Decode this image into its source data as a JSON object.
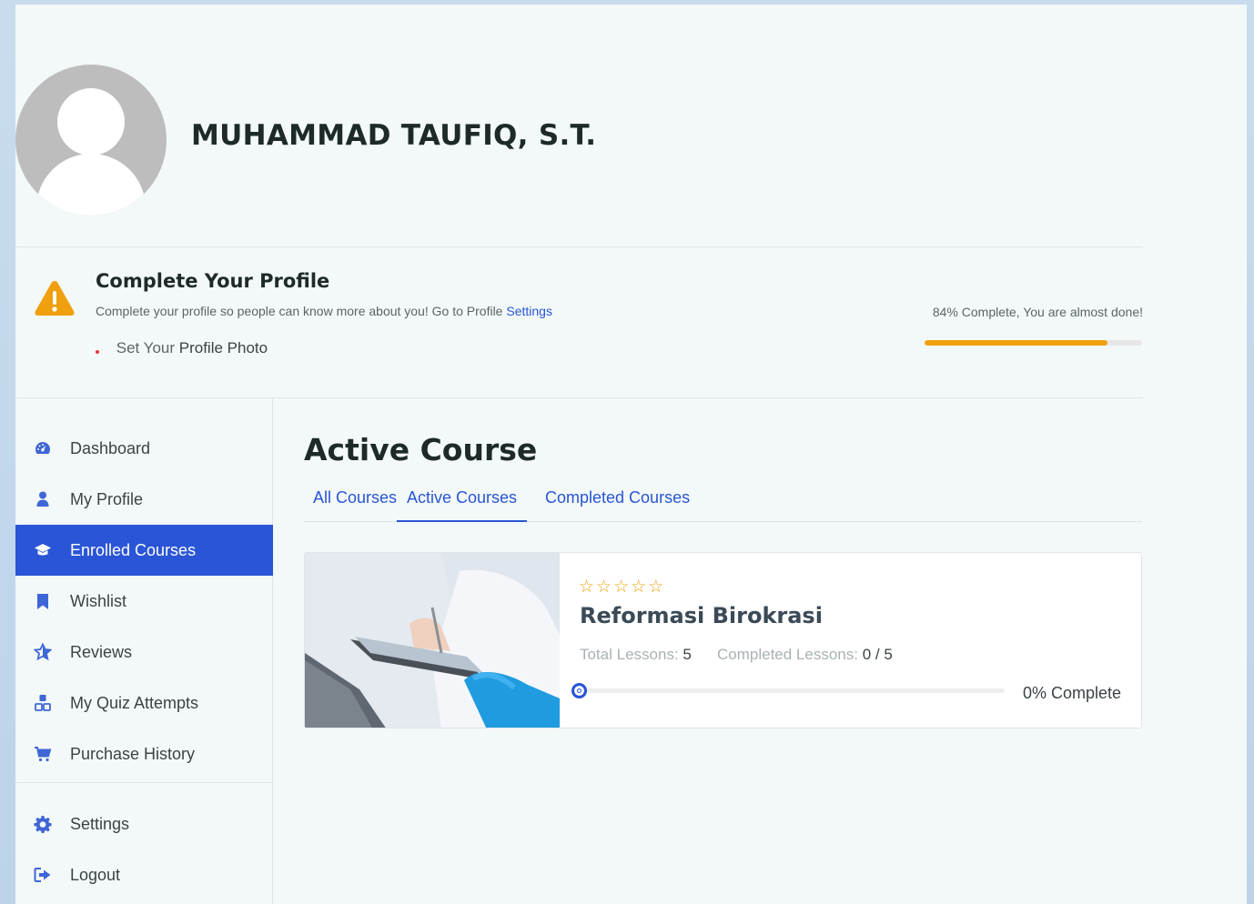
{
  "user": {
    "name": "MUHAMMAD TAUFIQ, S.T."
  },
  "profile_completion": {
    "title": "Complete Your Profile",
    "description": "Complete your profile so people can know more about you! Go to Profile",
    "settings_link": "Settings",
    "item_prefix": "Set Your",
    "item_label": "Profile Photo",
    "percent_text": "84% Complete, You are almost done!",
    "progress": 0.84,
    "bar_color": "#f0a00e"
  },
  "sidebar": {
    "items": [
      {
        "label": "Dashboard",
        "icon": "dashboard-icon"
      },
      {
        "label": "My Profile",
        "icon": "user-icon"
      },
      {
        "label": "Enrolled Courses",
        "icon": "graduation-cap-icon",
        "active": true
      },
      {
        "label": "Wishlist",
        "icon": "bookmark-icon"
      },
      {
        "label": "Reviews",
        "icon": "star-icon"
      },
      {
        "label": "My Quiz Attempts",
        "icon": "quiz-icon"
      },
      {
        "label": "Purchase History",
        "icon": "cart-icon"
      },
      {
        "label": "Settings",
        "icon": "gear-icon"
      },
      {
        "label": "Logout",
        "icon": "logout-icon"
      }
    ]
  },
  "main": {
    "title": "Active Course",
    "tabs": [
      {
        "label": "All Courses"
      },
      {
        "label": "Active Courses",
        "active": true
      },
      {
        "label": "Completed Courses"
      }
    ],
    "course": {
      "title": "Reformasi Birokrasi",
      "rating": 0,
      "total_lessons_label": "Total Lessons:",
      "total_lessons": "5",
      "completed_lessons_label": "Completed Lessons:",
      "completed_lessons": "0 / 5",
      "progress": 0,
      "complete_text": "0% Complete"
    }
  },
  "colors": {
    "accent": "#2a55d6",
    "warning": "#f0a00e"
  }
}
